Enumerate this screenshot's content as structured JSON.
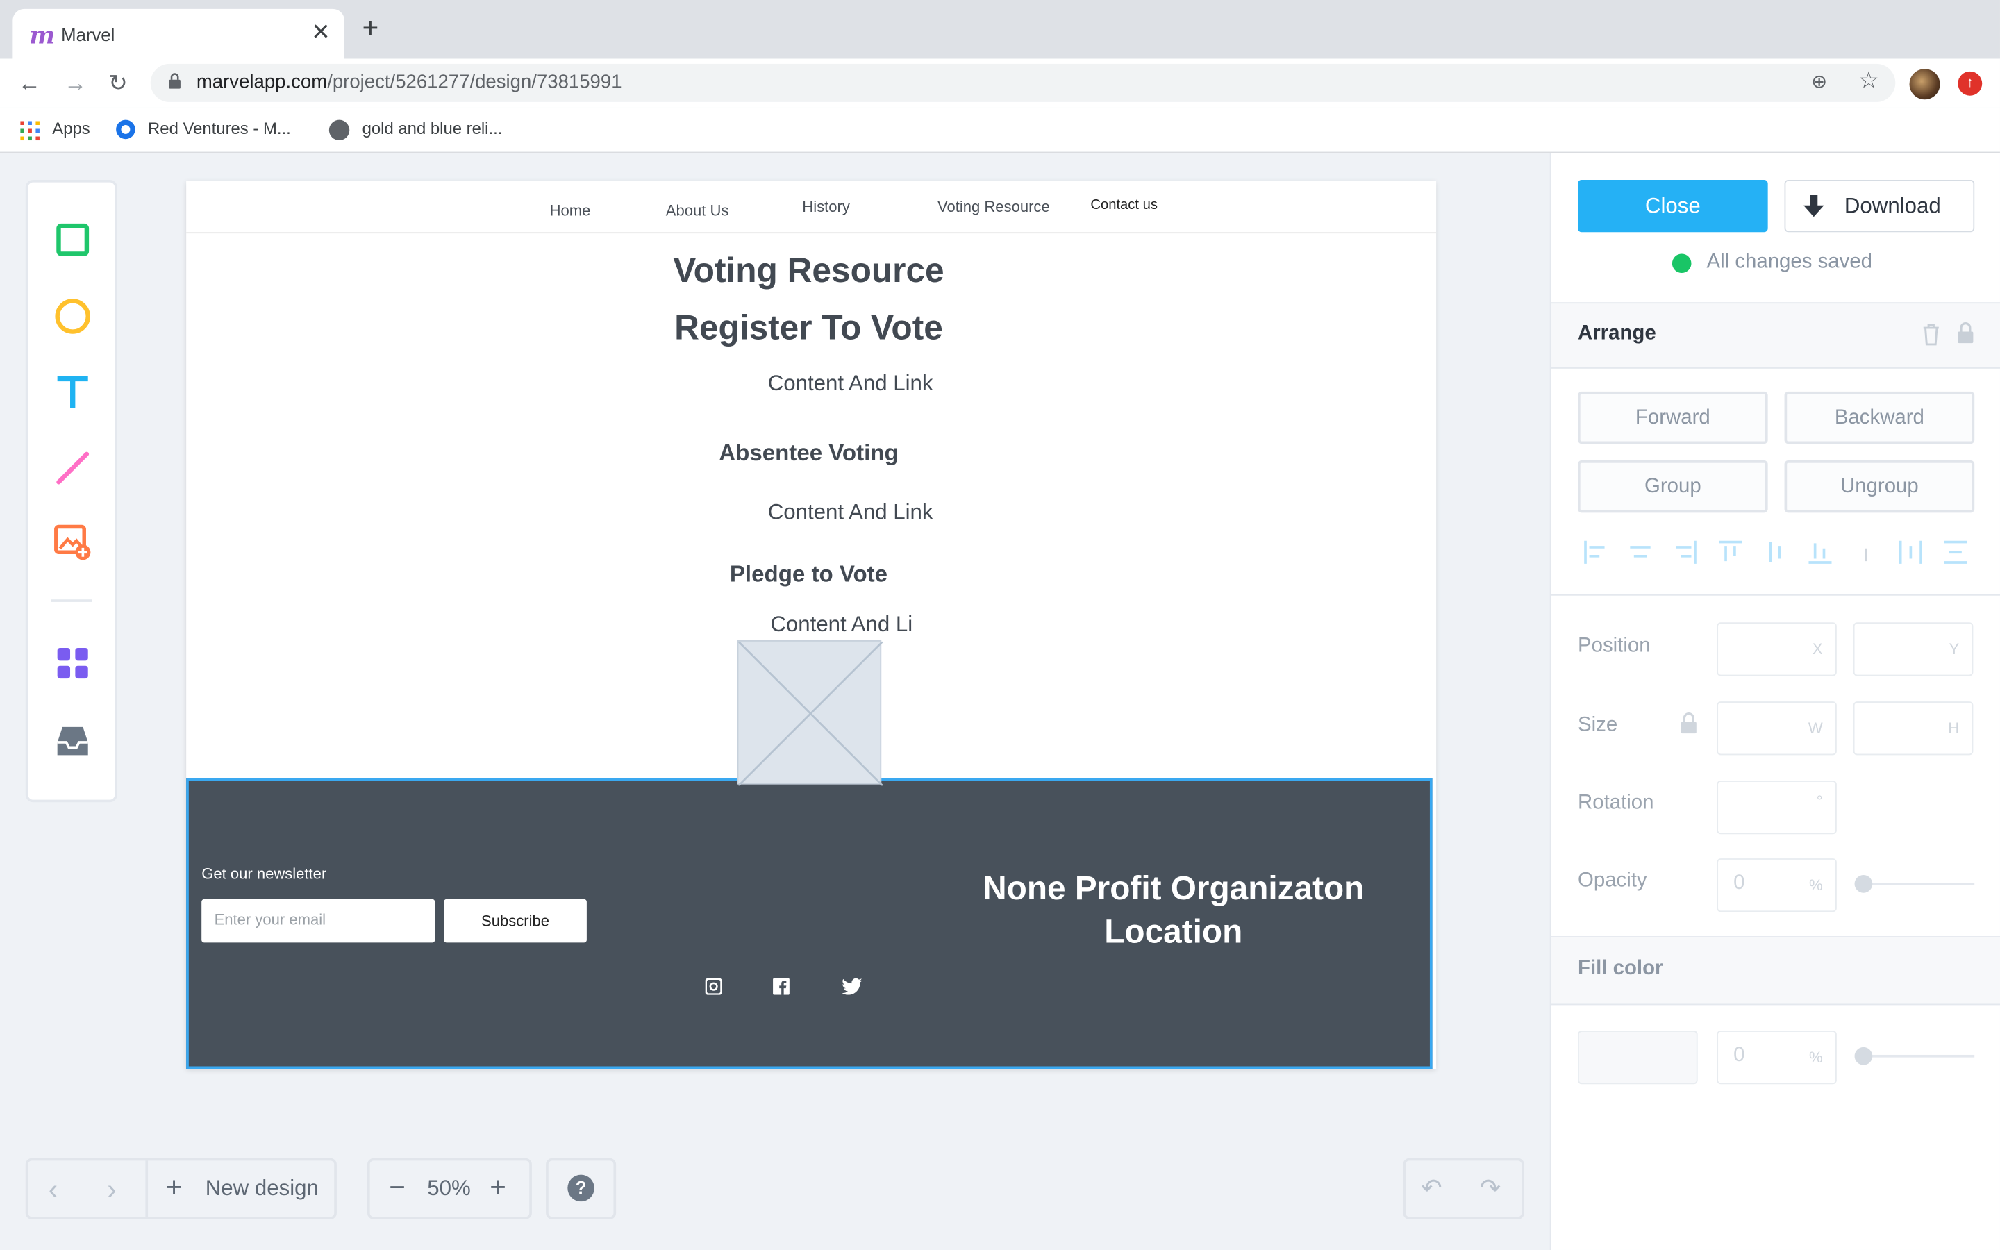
{
  "browser": {
    "tab_title": "Marvel",
    "tab_logo": "m",
    "url_host": "marvelapp.com",
    "url_path": "/project/5261277/design/73815991",
    "bookmarks": [
      {
        "label": "Apps",
        "icon": "apps-grid-icon"
      },
      {
        "label": "Red Ventures - M...",
        "icon": "circle-logo-icon"
      },
      {
        "label": "gold and blue reli...",
        "icon": "globe-icon"
      }
    ],
    "update_badge": "↑"
  },
  "tools": [
    "rectangle-tool",
    "circle-tool",
    "text-tool",
    "line-tool",
    "image-tool",
    "components-tool",
    "inbox-tool"
  ],
  "design": {
    "nav": [
      "Home",
      "About Us",
      "History",
      "Voting Resource",
      "Contact us"
    ],
    "title": "Voting Resource",
    "register": "Register To Vote",
    "content1": "Content And Link",
    "absentee": "Absentee Voting",
    "content2": "Content And Link",
    "pledge": "Pledge to Vote",
    "content3": "Content And Li",
    "footer": {
      "newsletter_label": "Get our newsletter",
      "email_placeholder": "Enter your email",
      "subscribe": "Subscribe",
      "org_line1": "None Profit Organizaton",
      "org_line2": "Location"
    }
  },
  "bottom": {
    "new_design": "New design",
    "zoom": "50%",
    "help": "?"
  },
  "panel": {
    "close": "Close",
    "download": "Download",
    "saved": "All changes saved",
    "arrange": "Arrange",
    "forward": "Forward",
    "backward": "Backward",
    "group": "Group",
    "ungroup": "Ungroup",
    "position": "Position",
    "size": "Size",
    "rotation": "Rotation",
    "opacity": "Opacity",
    "fill_color": "Fill color",
    "x": "X",
    "y": "Y",
    "w": "W",
    "h": "H",
    "deg": "°",
    "pct": "%",
    "opacity_value": "0",
    "fill_opacity_value": "0"
  },
  "colors": {
    "accent": "#25b1f5",
    "saved": "#19c566",
    "footer_bg": "#48515b"
  }
}
